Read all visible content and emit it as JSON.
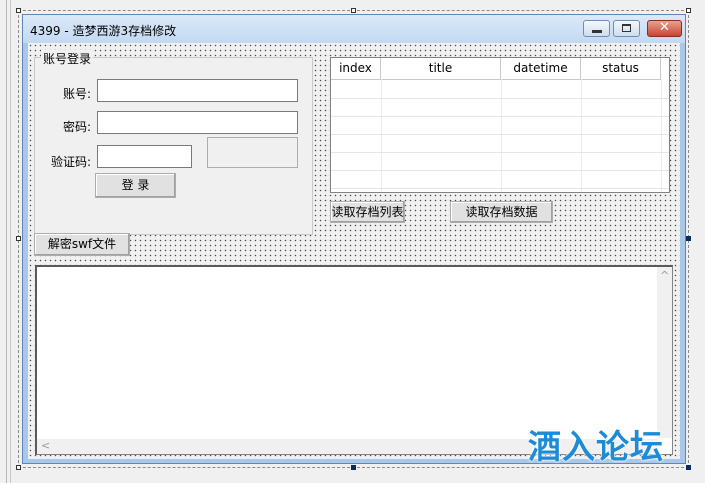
{
  "window": {
    "title": "4399 - 造梦西游3存档修改"
  },
  "login_group": {
    "caption": "账号登录",
    "account_label": "账号:",
    "password_label": "密码:",
    "captcha_label": "验证码:",
    "login_button": "登 录",
    "account_value": "",
    "password_value": "",
    "captcha_value": ""
  },
  "save_list": {
    "columns": [
      "index",
      "title",
      "datetime",
      "status"
    ],
    "rows": []
  },
  "buttons": {
    "read_list": "读取存档列表",
    "read_data": "读取存档数据",
    "decrypt_swf": "解密swf文件"
  },
  "output": {
    "text": ""
  },
  "scrollbar": {
    "up_arrow": "^",
    "left_arrow": "<"
  },
  "watermark": {
    "text": "酒入论坛"
  },
  "colors": {
    "accent": "#1e8bd6",
    "titlebar": "#c3d9f1",
    "close": "#c7462f"
  }
}
